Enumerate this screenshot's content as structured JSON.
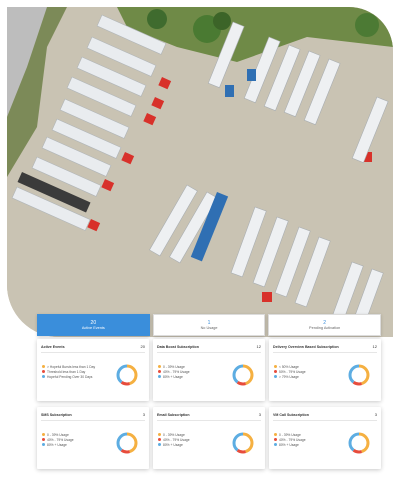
{
  "tabs": [
    {
      "count": "20",
      "label": "Active Events",
      "active": true
    },
    {
      "count": "1",
      "label": "No Usage",
      "active": false
    },
    {
      "count": "2",
      "label": "Pending Activation",
      "active": false
    }
  ],
  "cards": [
    {
      "title": "Active Events",
      "count": "20",
      "legend": [
        "> Hopeful Bursts less than 1 Day",
        "Threshold less than 1 Day",
        "Hopeful Pending Over 30 Days"
      ],
      "colors": [
        "#f5b041",
        "#e74c3c",
        "#5dade2"
      ]
    },
    {
      "title": "Data Boost Subscription",
      "count": "12",
      "legend": [
        "0 - 39% Usage",
        "40% - 79% Usage",
        "80% + Usage"
      ],
      "colors": [
        "#f5b041",
        "#e74c3c",
        "#5dade2"
      ]
    },
    {
      "title": "Delivery Overview Based Subscription",
      "count": "12",
      "legend": [
        "< 50% Usage",
        "50% - 79% Usage",
        "> 79% Usage"
      ],
      "colors": [
        "#f5b041",
        "#e74c3c",
        "#5dade2"
      ]
    },
    {
      "title": "SMS Subscription",
      "count": "3",
      "legend": [
        "0 - 39% Usage",
        "40% - 79% Usage",
        "80% + Usage"
      ],
      "colors": [
        "#f5b041",
        "#e74c3c",
        "#5dade2"
      ]
    },
    {
      "title": "Email Subscription",
      "count": "3",
      "legend": [
        "0 - 39% Usage",
        "40% - 79% Usage",
        "80% + Usage"
      ],
      "colors": [
        "#f5b041",
        "#e74c3c",
        "#5dade2"
      ]
    },
    {
      "title": "VM Call Subscription",
      "count": "3",
      "legend": [
        "0 - 39% Usage",
        "40% - 79% Usage",
        "80% + Usage"
      ],
      "colors": [
        "#f5b041",
        "#e74c3c",
        "#5dade2"
      ]
    }
  ]
}
